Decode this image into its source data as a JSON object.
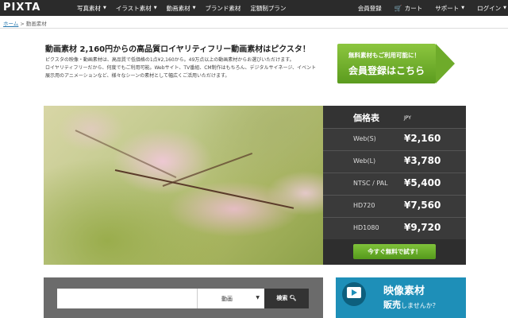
{
  "header": {
    "logo": "PIXTA",
    "nav": [
      {
        "label": "写真素材",
        "dropdown": true
      },
      {
        "label": "イラスト素材",
        "dropdown": true
      },
      {
        "label": "動画素材",
        "dropdown": true
      },
      {
        "label": "ブランド素材",
        "dropdown": false
      },
      {
        "label": "定額制プラン",
        "dropdown": false
      }
    ],
    "right": {
      "register": "会員登録",
      "cart": "カート",
      "support": "サポート",
      "login": "ログイン"
    }
  },
  "breadcrumb": {
    "home": "ホーム",
    "separator": ">",
    "current": "動画素材"
  },
  "intro": {
    "headline": "動画素材 2,160円からの高品質ロイヤリティフリー動画素材はピクスタ！",
    "lines": [
      "ピクスタの映像・動画素材は、高品質で低価格の1点¥2,160から。49万点以上の動画素材からお選びいただけます。",
      "ロイヤリティフリーだから、何度でもご利用可能。Webサイト、TV番組、CM制作はもちろん、デジタルサイネージ、イベント",
      "展示用のアニメーションなど、様々なシーンの素材として幅広くご活用いただけます。"
    ]
  },
  "cta": {
    "small": "無料素材もご利用可能に！",
    "big": "会員登録はこちら",
    "color": "#6eab2a"
  },
  "pricing": {
    "title": "価格表",
    "currency": "JPY",
    "rows": [
      {
        "label": "Web(S)",
        "price": "¥2,160"
      },
      {
        "label": "Web(L)",
        "price": "¥3,780"
      },
      {
        "label": "NTSC / PAL",
        "price": "¥5,400"
      },
      {
        "label": "HD720",
        "price": "¥7,560"
      },
      {
        "label": "HD1080",
        "price": "¥9,720"
      }
    ],
    "try_button": "今すぐ無料で試す！"
  },
  "search": {
    "input_value": "",
    "category": "動画",
    "button": "検索"
  },
  "banner": {
    "title": "映像素材",
    "line2_a": "販売",
    "line2_b": "しませんか？",
    "color": "#1e8fb8"
  }
}
